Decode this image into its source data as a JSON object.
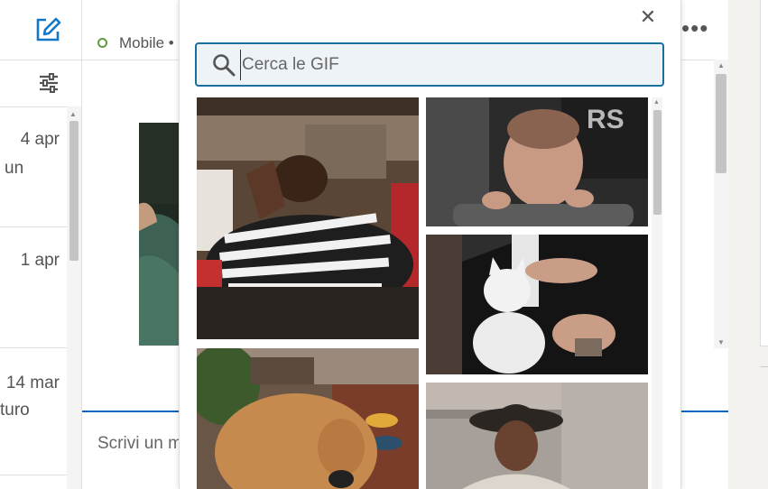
{
  "conversation_list": {
    "compose_icon": "compose-pencil-icon",
    "filter_icon": "filter-sliders-icon",
    "items": [
      {
        "date": "4 apr",
        "snippet": "un"
      },
      {
        "date": "1 apr",
        "snippet": ""
      },
      {
        "date": "14 mar",
        "snippet": "turo"
      }
    ]
  },
  "conversation": {
    "status": "Mobile •",
    "status_color": "#5f9b41",
    "more_icon": "more-dots-icon",
    "composer_placeholder": "Scrivi un m"
  },
  "gif_picker": {
    "close_icon": "close-icon",
    "search_icon": "search-icon",
    "search_placeholder": "Cerca le GIF",
    "gifs": [
      {
        "subject": "man in striped shirt laughing"
      },
      {
        "subject": "baby peeking over seat"
      },
      {
        "subject": "white cat being petted"
      },
      {
        "subject": "golden retriever dog"
      },
      {
        "subject": "man in cowboy hat"
      }
    ]
  },
  "colors": {
    "accent": "#0a66c2",
    "search_border": "#1a6fa1"
  }
}
